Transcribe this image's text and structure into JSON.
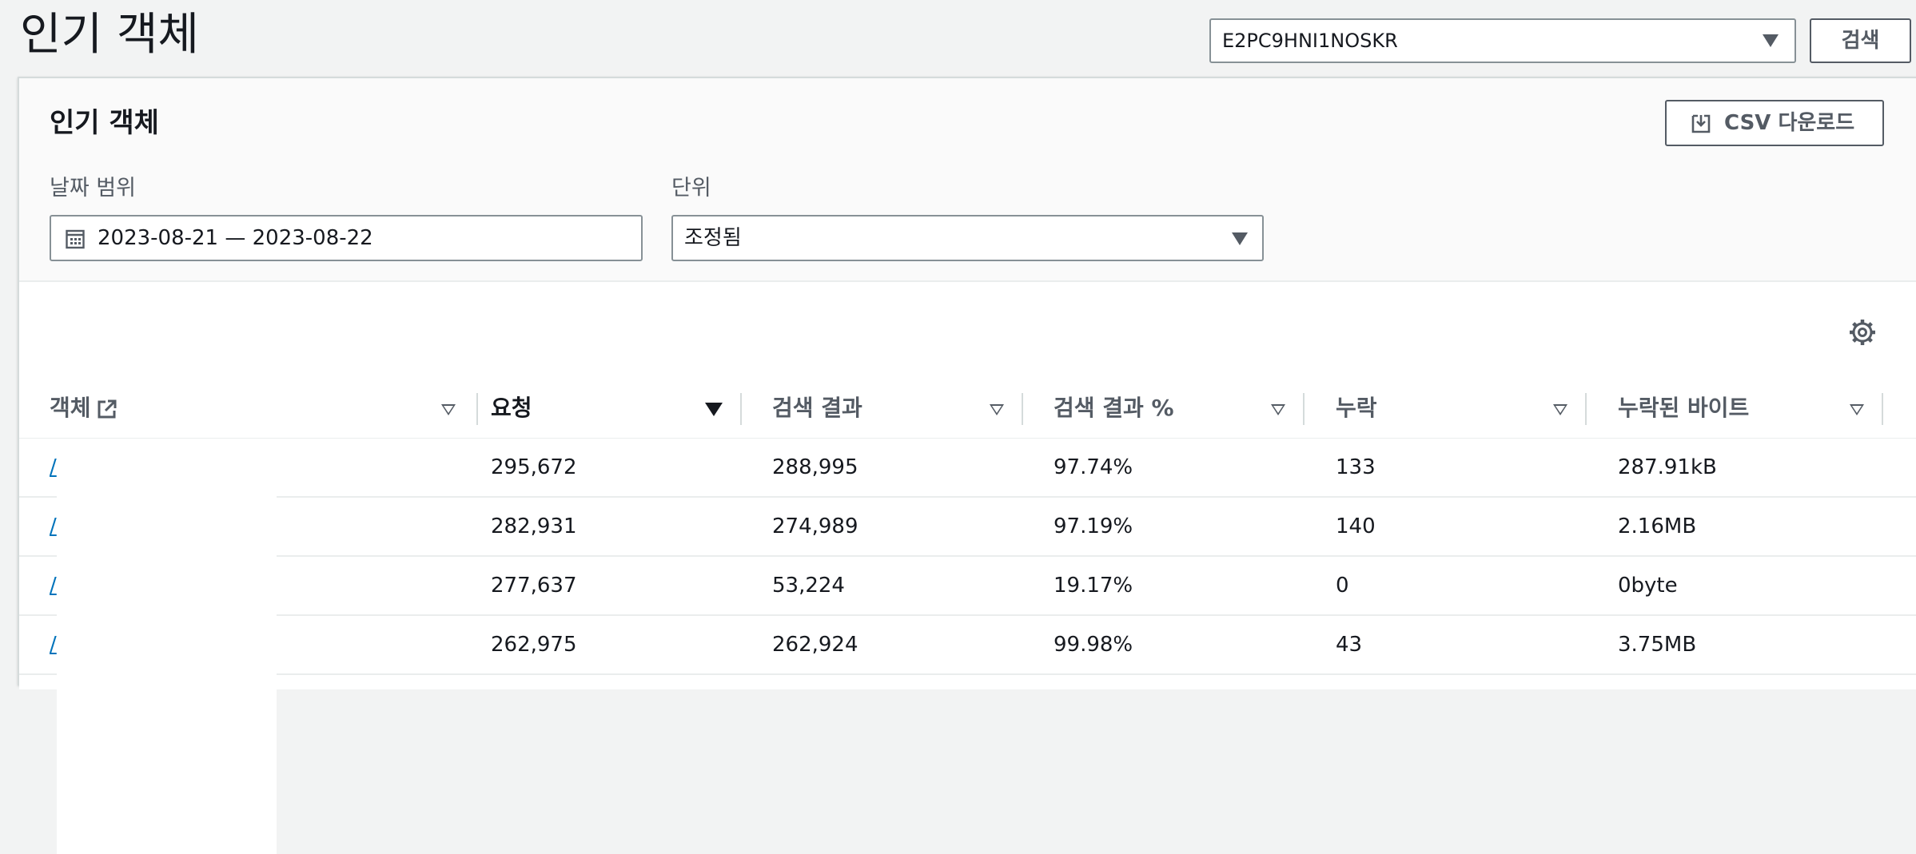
{
  "page": {
    "title": "인기 객체"
  },
  "distribution": {
    "selected": "E2PC9HNI1NOSKR",
    "search_label": "검색"
  },
  "panel": {
    "title": "인기 객체",
    "csv_label": "CSV 다운로드",
    "date_range_label": "날짜 범위",
    "date_range_value": "2023-08-21 — 2023-08-22",
    "unit_label": "단위",
    "unit_value": "조정됨"
  },
  "table": {
    "columns": [
      "객체",
      "요청",
      "검색 결과",
      "검색 결과 %",
      "누락",
      "누락된 바이트"
    ],
    "sorted_column": "요청",
    "rows": [
      {
        "object": "/",
        "requests": "295,672",
        "hits": "288,995",
        "hit_pct": "97.74%",
        "misses": "133",
        "miss_bytes": "287.91kB"
      },
      {
        "object": "/",
        "requests": "282,931",
        "hits": "274,989",
        "hit_pct": "97.19%",
        "misses": "140",
        "miss_bytes": "2.16MB"
      },
      {
        "object": "/",
        "requests": "277,637",
        "hits": "53,224",
        "hit_pct": "19.17%",
        "misses": "0",
        "miss_bytes": "0byte"
      },
      {
        "object": "/",
        "requests": "262,975",
        "hits": "262,924",
        "hit_pct": "99.98%",
        "misses": "43",
        "miss_bytes": "3.75MB"
      }
    ]
  },
  "icons": {
    "distribution_dropdown": "caret-down-icon",
    "csv": "download-icon",
    "date": "calendar-icon",
    "unit_dropdown": "caret-down-icon",
    "settings": "gear-icon",
    "object_external": "external-link-icon",
    "sort": "sort-caret-icon"
  },
  "colors": {
    "link": "#0073bb",
    "border": "#879196",
    "page_bg": "#f2f3f3"
  }
}
